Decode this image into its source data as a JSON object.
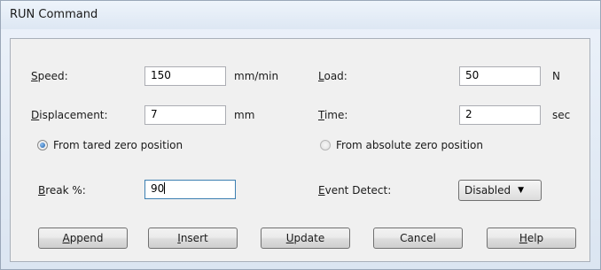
{
  "window": {
    "title": "RUN Command"
  },
  "form": {
    "speed": {
      "label_mnemonic": "S",
      "label_rest": "peed:",
      "value": "150",
      "unit": "mm/min"
    },
    "displacement": {
      "label_mnemonic": "D",
      "label_rest": "isplacement:",
      "value": "7",
      "unit": "mm"
    },
    "load": {
      "label_mnemonic": "L",
      "label_rest": "oad:",
      "value": "50",
      "unit": "N"
    },
    "time": {
      "label_mnemonic": "T",
      "label_rest": "ime:",
      "value": "2",
      "unit": "sec"
    },
    "zero_tared": {
      "label": "From tared zero position",
      "selected": true
    },
    "zero_absolute": {
      "label": "From absolute zero position",
      "selected": false
    },
    "break_pct": {
      "label_mnemonic": "B",
      "label_rest": "reak %:",
      "value": "90"
    },
    "event_detect": {
      "label_mnemonic": "E",
      "label_rest": "vent Detect:",
      "value": "Disabled"
    }
  },
  "buttons": {
    "append": {
      "mnemonic": "A",
      "rest": "ppend"
    },
    "insert": {
      "mnemonic": "I",
      "rest": "nsert"
    },
    "update": {
      "mnemonic": "U",
      "rest": "pdate"
    },
    "cancel": {
      "label": "Cancel"
    },
    "help": {
      "mnemonic": "H",
      "rest": "elp"
    }
  }
}
